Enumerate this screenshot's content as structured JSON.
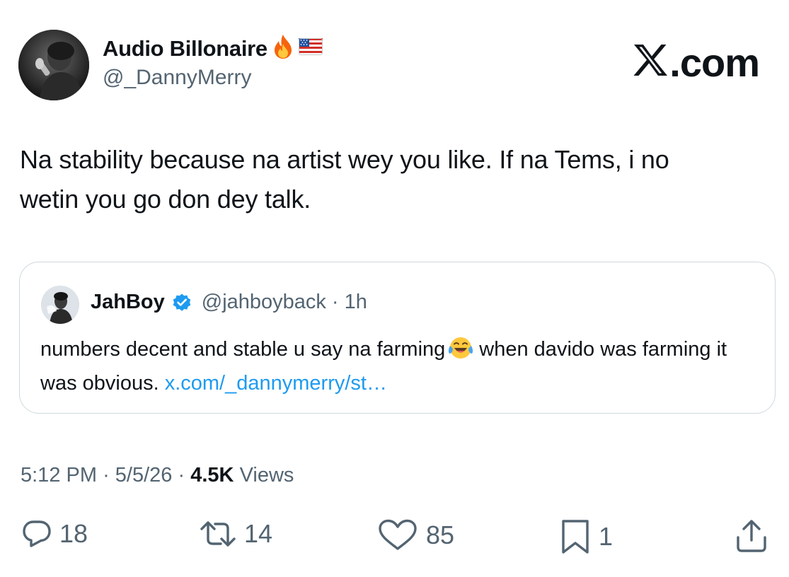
{
  "author": {
    "display_name": "Audio Billonaire",
    "name_emojis": [
      "fire-emoji",
      "us-flag-emoji"
    ],
    "handle": "@_DannyMerry"
  },
  "brand": {
    "text": ".com",
    "logo": "x-logo"
  },
  "tweet": {
    "line1": "Na stability because na artist wey you like. If na Tems, i no",
    "line2": "wetin you go don dey talk."
  },
  "quoted": {
    "display_name": "JahBoy",
    "verified": true,
    "handle": "@jahboyback",
    "separator": "·",
    "time": "1h",
    "text_part1": "numbers decent and stable u say na farming",
    "emoji": "face-with-tears-of-joy",
    "text_part2": "when davido was farming it was obvious.",
    "link_text": "x.com/_dannymerry/st…"
  },
  "meta": {
    "time": "5:12 PM",
    "date": "5/5/26",
    "separator": "·",
    "views_count": "4.5K",
    "views_label": "Views"
  },
  "actions": {
    "replies": "18",
    "reposts": "14",
    "likes": "85",
    "bookmarks": "1"
  },
  "colors": {
    "text": "#0f1419",
    "secondary": "#536471",
    "link": "#1d9bf0",
    "border": "#cfd9de"
  }
}
